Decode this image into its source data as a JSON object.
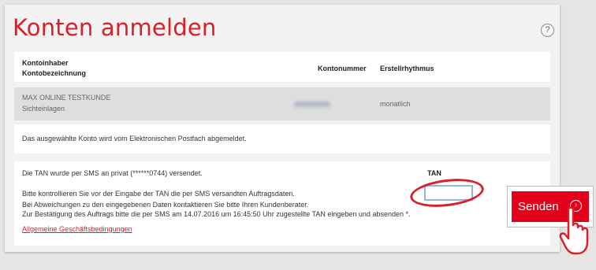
{
  "page": {
    "title": "Konten anmelden",
    "help_icon": "question-circle-icon",
    "help_label": "?"
  },
  "table": {
    "col_holder": "Kontoinhaber",
    "col_name": "Kontobezeichnung",
    "col_number": "Kontonummer",
    "col_rhythm": "Erstellrhythmus",
    "row": {
      "holder": "MAX ONLINE TESTKUNDE",
      "name": "Sichteinlagen",
      "rhythm": "monatlich"
    }
  },
  "notice": "Das ausgewählte Konto wird vom Elektronischen Postfach abgemeldet.",
  "tan": {
    "sent_text": "Die TAN wurde per SMS an privat (******0744) versendet.",
    "label": "TAN",
    "input_value": "",
    "check_text": "Bitte kontrollieren Sie vor der Eingabe der TAN die per SMS versandten Auftragsdaten.",
    "deviation_text": "Bei Abweichungen zu den eingegebenen Daten kontaktieren Sie bitte Ihren Kundenberater.",
    "confirm_text": "Zur Bestätigung des Auftrags bitte die per SMS am 14.07.2016 um 16:45:50 Uhr zugestellte TAN eingeben und absenden *.",
    "terms_link": "Allgemeine Geschäftsbedingungen"
  },
  "send_button": {
    "label": "Senden",
    "icon": "chevron-right-circle-icon",
    "icon_glyph": "›"
  },
  "cursor_icon": "hand-pointer-icon",
  "colors": {
    "accent": "#d9202a",
    "button": "#e2001a"
  }
}
